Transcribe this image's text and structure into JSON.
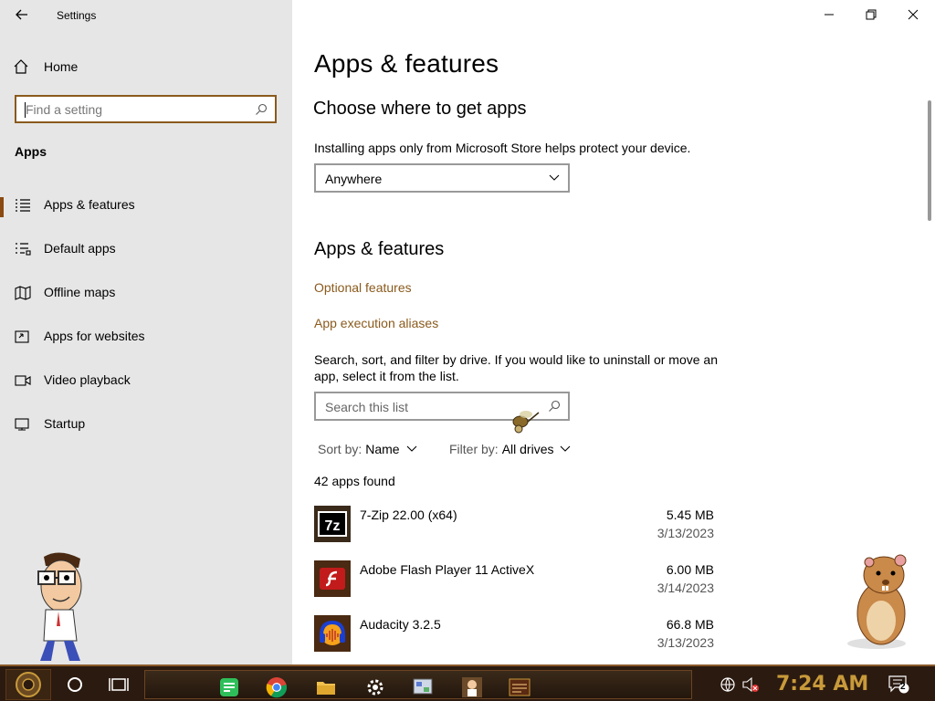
{
  "window": {
    "title": "Settings"
  },
  "sidebar": {
    "home_label": "Home",
    "search_placeholder": "Find a setting",
    "section_label": "Apps",
    "items": [
      {
        "label": "Apps & features",
        "icon": "apps-features-icon",
        "selected": true
      },
      {
        "label": "Default apps",
        "icon": "default-apps-icon",
        "selected": false
      },
      {
        "label": "Offline maps",
        "icon": "offline-maps-icon",
        "selected": false
      },
      {
        "label": "Apps for websites",
        "icon": "apps-for-websites-icon",
        "selected": false
      },
      {
        "label": "Video playback",
        "icon": "video-playback-icon",
        "selected": false
      },
      {
        "label": "Startup",
        "icon": "startup-icon",
        "selected": false
      }
    ]
  },
  "main": {
    "page_title": "Apps & features",
    "choose_heading": "Choose where to get apps",
    "choose_desc": "Installing apps only from Microsoft Store helps protect your device.",
    "source_selected": "Anywhere",
    "features_heading": "Apps & features",
    "optional_features_link": "Optional features",
    "aliases_link": "App execution aliases",
    "list_desc_line1": "Search, sort, and filter by drive. If you would like to uninstall or move an",
    "list_desc_line2": "app, select it from the list.",
    "list_search_placeholder": "Search this list",
    "sort_label": "Sort by:",
    "sort_value": "Name",
    "filter_label": "Filter by:",
    "filter_value": "All drives",
    "apps_count": "42 apps found",
    "apps": [
      {
        "name": "7-Zip 22.00 (x64)",
        "size": "5.45 MB",
        "date": "3/13/2023",
        "icon": "7zip-icon"
      },
      {
        "name": "Adobe Flash Player 11 ActiveX",
        "size": "6.00 MB",
        "date": "3/14/2023",
        "icon": "flash-player-icon"
      },
      {
        "name": "Audacity 3.2.5",
        "size": "66.8 MB",
        "date": "3/13/2023",
        "icon": "audacity-icon"
      }
    ]
  },
  "taskbar": {
    "clock": "7:24 AM",
    "notification_count": "2"
  },
  "colors": {
    "accent": "#8a5a1c",
    "sidebar_bg": "#e6e6e6",
    "taskbar_bg": "#2b1a10"
  }
}
